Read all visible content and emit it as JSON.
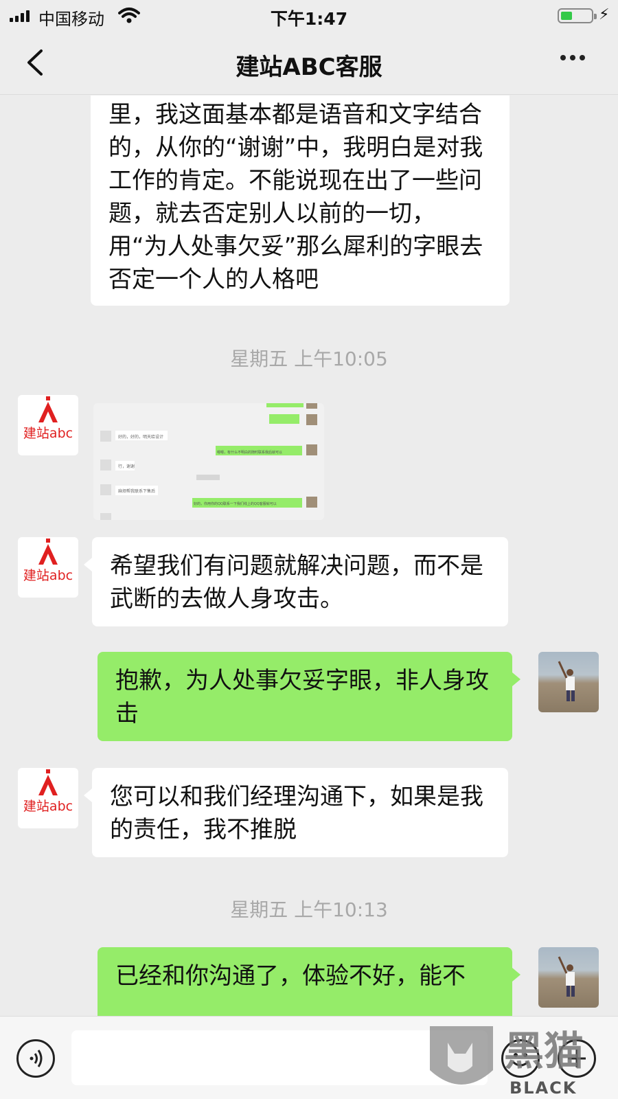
{
  "status_bar": {
    "carrier": "中国移动",
    "time": "下午1:47"
  },
  "nav": {
    "title": "建站ABC客服"
  },
  "messages": {
    "m1": "东先生，你可以看一下咱们的沟通里，我这面基本都是语音和文字结合的，从你的“谢谢”中，我明白是对我工作的肯定。不能说现在出了一些问题，就去否定别人以前的一切，用“为人处事欠妥”那么犀利的字眼去否定一个人的人格吧",
    "ts1": "星期五 上午10:05",
    "m3": "希望我们有问题就解决问题，而不是武断的去做人身攻击。",
    "m4": "抱歉，为人处事欠妥字眼，非人身攻击",
    "m5": "您可以和我们经理沟通下，如果是我的责任，我不推脱",
    "ts2": "星期五 上午10:13",
    "m6": "已经和你沟通了，体验不好，能不"
  },
  "avatar_logo": {
    "text": "建站abc",
    "brand_color": "#e02020"
  },
  "screenshot_thumb": {
    "rows": [
      {
        "side": "in",
        "text": "好的，好的，明天给设计"
      },
      {
        "side": "out",
        "text": "嗯嗯，有什么不明白的随时联系我后就可以"
      },
      {
        "side": "in",
        "text": "行，谢谢"
      },
      {
        "side": "in",
        "text": "麻烦帮我联系下售后"
      },
      {
        "side": "out",
        "text": "好的，你用你的QQ联系一下我们线上的QQ客服就可以"
      }
    ]
  },
  "icons": [
    "signal-icon",
    "wifi-icon",
    "battery-icon",
    "back-icon",
    "more-icon",
    "voice-icon",
    "emoji-icon",
    "plus-icon"
  ],
  "watermark": {
    "line1": "黑猫",
    "line2": "BLACK CAT"
  },
  "colors": {
    "outgoing_bubble": "#95ec69",
    "incoming_bubble": "#ffffff",
    "background": "#ececec"
  }
}
